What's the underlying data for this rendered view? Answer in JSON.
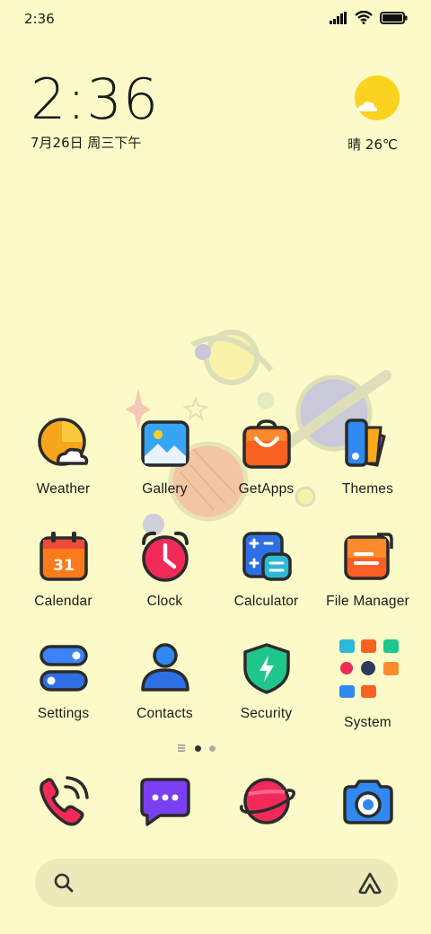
{
  "status_bar": {
    "time": "2:36"
  },
  "clock_widget": {
    "time": "2:36",
    "date": "7月26日 周三下午"
  },
  "weather_widget": {
    "text": "晴 26℃"
  },
  "apps": [
    {
      "label": "Weather"
    },
    {
      "label": "Gallery"
    },
    {
      "label": "GetApps"
    },
    {
      "label": "Themes"
    },
    {
      "label": "Calendar"
    },
    {
      "label": "Clock"
    },
    {
      "label": "Calculator"
    },
    {
      "label": "File Manager"
    },
    {
      "label": "Settings"
    },
    {
      "label": "Contacts"
    },
    {
      "label": "Security"
    },
    {
      "label": "System"
    }
  ],
  "calendar_day": "31",
  "dock": [
    "phone-icon",
    "messages-icon",
    "browser-icon",
    "camera-icon"
  ],
  "colors": {
    "background": "#fbfac8",
    "search_bar": "#eceab9"
  }
}
